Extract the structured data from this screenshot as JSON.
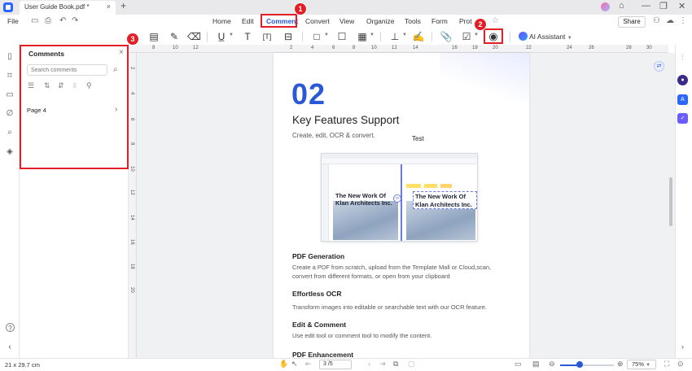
{
  "titlebar": {
    "tab_title": "User Guide Book.pdf *",
    "tab_close": "×",
    "new_tab": "+",
    "minimize": "—",
    "maximize": "❐",
    "close": "✕"
  },
  "menu": {
    "file": "File",
    "items": [
      "Home",
      "Edit",
      "Comment",
      "Convert",
      "View",
      "Organize",
      "Tools",
      "Form",
      "Prot"
    ],
    "share": "Share"
  },
  "toolbar": {
    "ai_assistant": "AI Assistant",
    "icons": [
      "sticky-note-icon",
      "pencil-icon",
      "eraser-icon",
      "underline-icon",
      "text-comment-icon",
      "text-box-icon",
      "callout-icon",
      "shape-icon",
      "note-icon",
      "area-highlight-icon",
      "stamp-icon",
      "signature-icon",
      "attachment-icon",
      "markup-icon",
      "show-hide-comments-icon"
    ]
  },
  "comments_panel": {
    "title": "Comments",
    "close": "×",
    "search_placeholder": "Search comments",
    "page_item": "Page 4",
    "page_chevron": "›"
  },
  "ruler": {
    "h_ticks": [
      "8",
      "10",
      "12",
      "2",
      "4",
      "6",
      "8",
      "10",
      "12",
      "14",
      "16",
      "18",
      "20",
      "22",
      "24",
      "26",
      "28",
      "30"
    ],
    "v_ticks": [
      "2",
      "4",
      "6",
      "8",
      "10",
      "12",
      "14",
      "16",
      "18",
      "20"
    ]
  },
  "document": {
    "section_number": "02",
    "title": "Key Features Support",
    "subtitle": "Create, edit, OCR & convert.",
    "test_label": "Test",
    "illustration_left_text": "The New Work Of\nKlan Architects Inc.",
    "illustration_right_text": "The New Work Of\nKlan Architects Inc.",
    "sections": [
      {
        "heading": "PDF Generation",
        "body": "Create a PDF from scratch, upload from the Template Mall or Cloud,scan, convert from different formats, or open from your clipboard"
      },
      {
        "heading": "Effortless OCR",
        "body": "Transform images into editable or searchable text with our OCR feature."
      },
      {
        "heading": "Edit & Comment",
        "body": "Use edit tool or comment tool to modify the content."
      },
      {
        "heading": "PDF Enhancement",
        "body": ""
      }
    ]
  },
  "statusbar": {
    "page_size": "21 x 29.7 cm",
    "page_indicator": "3 /5",
    "zoom": "75%",
    "zoom_level": 0.36
  },
  "annotations": {
    "badge1": "1",
    "badge2": "2",
    "badge3": "3"
  },
  "colors": {
    "accent": "#2a59d8",
    "annotation_red": "#e21f26"
  }
}
